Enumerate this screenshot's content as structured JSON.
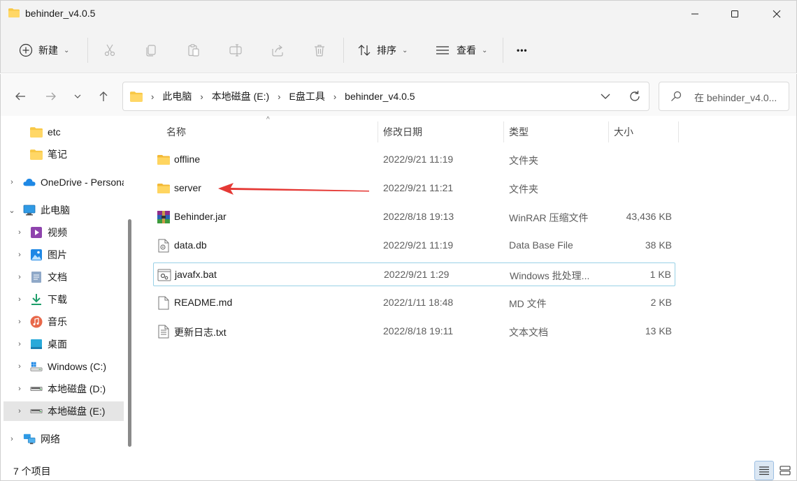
{
  "window": {
    "title": "behinder_v4.0.5"
  },
  "toolbar": {
    "new_label": "新建",
    "sort_label": "排序",
    "view_label": "查看",
    "more_label": "•••"
  },
  "address": {
    "crumbs": [
      "此电脑",
      "本地磁盘 (E:)",
      "E盘工具",
      "behinder_v4.0.5"
    ],
    "search_placeholder": "在 behinder_v4.0..."
  },
  "sidebar": {
    "items": [
      {
        "label": "etc",
        "icon": "folder-icon"
      },
      {
        "label": "笔记",
        "icon": "folder-icon"
      },
      {
        "label": "OneDrive - Personal",
        "icon": "cloud-icon"
      },
      {
        "label": "此电脑",
        "icon": "computer-icon"
      },
      {
        "label": "视频",
        "icon": "video-icon"
      },
      {
        "label": "图片",
        "icon": "picture-icon"
      },
      {
        "label": "文档",
        "icon": "document-icon"
      },
      {
        "label": "下载",
        "icon": "download-icon"
      },
      {
        "label": "音乐",
        "icon": "music-icon"
      },
      {
        "label": "桌面",
        "icon": "desktop-icon"
      },
      {
        "label": "Windows (C:)",
        "icon": "windows-drive-icon"
      },
      {
        "label": "本地磁盘 (D:)",
        "icon": "drive-icon"
      },
      {
        "label": "本地磁盘 (E:)",
        "icon": "drive-icon"
      },
      {
        "label": "网络",
        "icon": "network-icon"
      }
    ]
  },
  "columns": {
    "name": "名称",
    "date": "修改日期",
    "type": "类型",
    "size": "大小"
  },
  "files": [
    {
      "name": "offline",
      "date": "2022/9/21 11:19",
      "type": "文件夹",
      "size": "",
      "icon": "folder-icon"
    },
    {
      "name": "server",
      "date": "2022/9/21 11:21",
      "type": "文件夹",
      "size": "",
      "icon": "folder-icon"
    },
    {
      "name": "Behinder.jar",
      "date": "2022/8/18 19:13",
      "type": "WinRAR 压缩文件",
      "size": "43,436 KB",
      "icon": "winrar-archive-icon"
    },
    {
      "name": "data.db",
      "date": "2022/9/21 11:19",
      "type": "Data Base File",
      "size": "38 KB",
      "icon": "db-file-icon"
    },
    {
      "name": "javafx.bat",
      "date": "2022/9/21 1:29",
      "type": "Windows 批处理...",
      "size": "1 KB",
      "icon": "batch-file-icon"
    },
    {
      "name": "README.md",
      "date": "2022/1/11 18:48",
      "type": "MD 文件",
      "size": "2 KB",
      "icon": "blank-file-icon"
    },
    {
      "name": "更新日志.txt",
      "date": "2022/8/18 19:11",
      "type": "文本文档",
      "size": "13 KB",
      "icon": "text-file-icon"
    }
  ],
  "status": {
    "item_count": "7 个项目"
  },
  "colors": {
    "folder": "#f8c846",
    "arrow": "#e53935",
    "selection": "#e5e5e5",
    "focus_border": "#99d1e6"
  }
}
